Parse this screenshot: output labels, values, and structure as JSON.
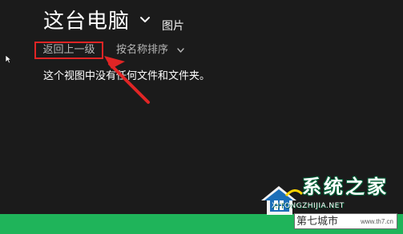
{
  "header": {
    "title": "这台电脑",
    "subtitle": "图片",
    "title_chevron": "chevron-down-icon"
  },
  "toolbar": {
    "back_label": "返回上一级",
    "sort_label": "按名称排序",
    "sort_chevron": "chevron-down-icon"
  },
  "content": {
    "empty_message": "这个视图中没有任何文件和文件夹。"
  },
  "annotation": {
    "arrow_color": "#e02525",
    "highlight_color": "#e02525"
  },
  "watermark": {
    "brand": "系统之家",
    "domain": "XITONGZHIJIA.NET",
    "site_name": "第七城市",
    "site_url": "www.th7.cn"
  },
  "colors": {
    "window_bg": "#1b1b1b",
    "accent_green": "#1fb45a",
    "text_primary": "#ffffff",
    "text_secondary": "#b7b7b7"
  }
}
